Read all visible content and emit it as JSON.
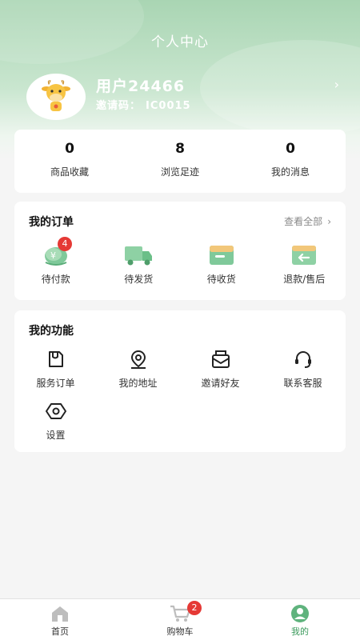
{
  "header": {
    "title": "个人中心"
  },
  "profile": {
    "username": "用户24466",
    "invite_label": "邀请码：",
    "invite_code": "IC0015"
  },
  "stats": [
    {
      "value": "0",
      "label": "商品收藏"
    },
    {
      "value": "8",
      "label": "浏览足迹"
    },
    {
      "value": "0",
      "label": "我的消息"
    }
  ],
  "orders": {
    "title": "我的订单",
    "view_all": "查看全部",
    "items": [
      {
        "label": "待付款",
        "badge": "4",
        "icon": "wallet-icon"
      },
      {
        "label": "待发货",
        "icon": "truck-icon"
      },
      {
        "label": "待收货",
        "icon": "box-icon"
      },
      {
        "label": "退款/售后",
        "icon": "refund-icon"
      }
    ]
  },
  "functions": {
    "title": "我的功能",
    "items": [
      {
        "label": "服务订单",
        "icon": "service-order-icon"
      },
      {
        "label": "我的地址",
        "icon": "location-icon"
      },
      {
        "label": "邀请好友",
        "icon": "invite-mail-icon"
      },
      {
        "label": "联系客服",
        "icon": "headset-icon"
      },
      {
        "label": "设置",
        "icon": "settings-icon"
      }
    ]
  },
  "tabbar": {
    "items": [
      {
        "label": "首页",
        "icon": "home-icon"
      },
      {
        "label": "购物车",
        "icon": "cart-icon",
        "badge": "2"
      },
      {
        "label": "我的",
        "icon": "profile-icon",
        "active": true
      }
    ]
  },
  "colors": {
    "accent": "#3a9a5b",
    "badge": "#e53935",
    "hero": "#a9d5b3"
  }
}
